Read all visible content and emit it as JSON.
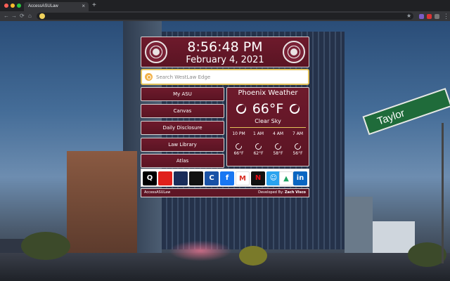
{
  "browser": {
    "tab_title": "AccessASULaw",
    "tab_close": "×",
    "new_tab": "+",
    "nav_back": "←",
    "nav_forward": "→",
    "nav_reload": "⟳",
    "nav_home": "⌂",
    "star": "★",
    "menu": "⋮"
  },
  "scene": {
    "street_sign": "Taylor"
  },
  "clock": {
    "time": "8:56:48 PM",
    "date": "February 4, 2021"
  },
  "search": {
    "placeholder": "Search WestLaw Edge"
  },
  "links": [
    {
      "label": "My ASU"
    },
    {
      "label": "Canvas"
    },
    {
      "label": "Daily Disclosure"
    },
    {
      "label": "Law Library"
    },
    {
      "label": "Atlas"
    }
  ],
  "weather": {
    "title": "Phoenix Weather",
    "current_temp": "66°F",
    "condition": "Clear Sky",
    "forecast": [
      {
        "time": "10 PM",
        "temp": "66°F"
      },
      {
        "time": "1 AM",
        "temp": "62°F"
      },
      {
        "time": "4 AM",
        "temp": "58°F"
      },
      {
        "time": "7 AM",
        "temp": "56°F"
      }
    ]
  },
  "shortcuts": [
    {
      "name": "quimbee",
      "glyph": "Q",
      "color": "#000000"
    },
    {
      "name": "lexis",
      "glyph": "",
      "color": "#e0201b"
    },
    {
      "name": "westlaw",
      "glyph": "",
      "color": "#1a2d5a"
    },
    {
      "name": "bloomberg",
      "glyph": "",
      "color": "#111111"
    },
    {
      "name": "cengage",
      "glyph": "C",
      "color": "#1a52a6"
    },
    {
      "name": "facebook",
      "glyph": "f",
      "color": "#1877f2"
    },
    {
      "name": "gmail",
      "glyph": "M",
      "color": "#ffffff"
    },
    {
      "name": "netflix",
      "glyph": "N",
      "color": "#111111"
    },
    {
      "name": "messenger",
      "glyph": "☺",
      "color": "#2aa3ef"
    },
    {
      "name": "google-drive",
      "glyph": "▲",
      "color": "#ffffff"
    },
    {
      "name": "linkedin",
      "glyph": "in",
      "color": "#0a66c2"
    }
  ],
  "footer": {
    "left": "AccessASULaw",
    "right_prefix": "Developed By:",
    "right_name": "Zach Visco"
  }
}
